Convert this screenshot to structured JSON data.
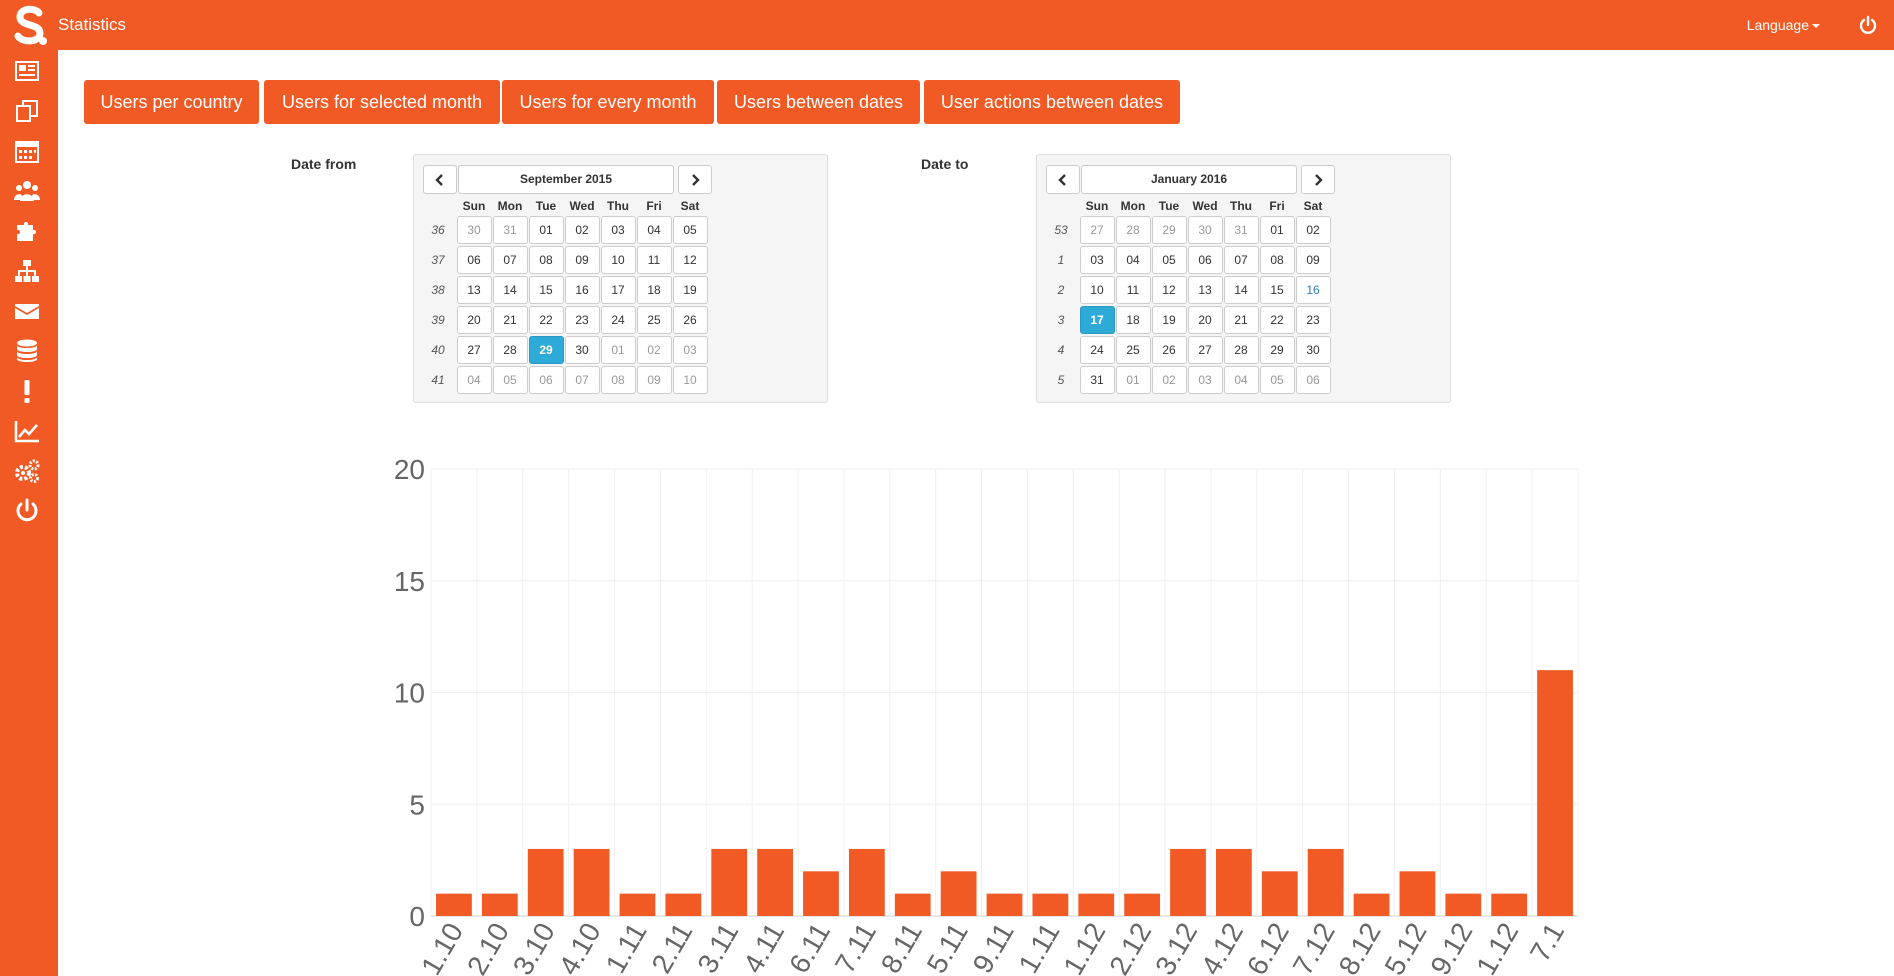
{
  "header": {
    "title": "Statistics",
    "language_label": "Language",
    "brand_color": "#f15a24"
  },
  "sidebar": {
    "icons": [
      "newspaper-icon",
      "copy-icon",
      "calendar-icon",
      "users-icon",
      "puzzle-icon",
      "sitemap-icon",
      "envelope-icon",
      "database-icon",
      "exclamation-icon",
      "line-chart-icon",
      "gears-icon",
      "power-icon"
    ]
  },
  "tabs": [
    {
      "label": "Users per country"
    },
    {
      "label": "Users for selected month"
    },
    {
      "label": "Users for every month"
    },
    {
      "label": "Users between dates"
    },
    {
      "label": "User actions between dates"
    }
  ],
  "date_from": {
    "label": "Date from",
    "month": "September 2015",
    "weekdays": [
      "Sun",
      "Mon",
      "Tue",
      "Wed",
      "Thu",
      "Fri",
      "Sat"
    ],
    "weeks": [
      {
        "num": "36",
        "days": [
          [
            "30",
            1
          ],
          [
            "31",
            1
          ],
          [
            "01",
            0
          ],
          [
            "02",
            0
          ],
          [
            "03",
            0
          ],
          [
            "04",
            0
          ],
          [
            "05",
            0
          ]
        ]
      },
      {
        "num": "37",
        "days": [
          [
            "06",
            0
          ],
          [
            "07",
            0
          ],
          [
            "08",
            0
          ],
          [
            "09",
            0
          ],
          [
            "10",
            0
          ],
          [
            "11",
            0
          ],
          [
            "12",
            0
          ]
        ]
      },
      {
        "num": "38",
        "days": [
          [
            "13",
            0
          ],
          [
            "14",
            0
          ],
          [
            "15",
            0
          ],
          [
            "16",
            0
          ],
          [
            "17",
            0
          ],
          [
            "18",
            0
          ],
          [
            "19",
            0
          ]
        ]
      },
      {
        "num": "39",
        "days": [
          [
            "20",
            0
          ],
          [
            "21",
            0
          ],
          [
            "22",
            0
          ],
          [
            "23",
            0
          ],
          [
            "24",
            0
          ],
          [
            "25",
            0
          ],
          [
            "26",
            0
          ]
        ]
      },
      {
        "num": "40",
        "days": [
          [
            "27",
            0
          ],
          [
            "28",
            0
          ],
          [
            "29",
            2
          ],
          [
            "30",
            0
          ],
          [
            "01",
            1
          ],
          [
            "02",
            1
          ],
          [
            "03",
            1
          ]
        ]
      },
      {
        "num": "41",
        "days": [
          [
            "04",
            1
          ],
          [
            "05",
            1
          ],
          [
            "06",
            1
          ],
          [
            "07",
            1
          ],
          [
            "08",
            1
          ],
          [
            "09",
            1
          ],
          [
            "10",
            1
          ]
        ]
      }
    ]
  },
  "date_to": {
    "label": "Date to",
    "month": "January 2016",
    "weekdays": [
      "Sun",
      "Mon",
      "Tue",
      "Wed",
      "Thu",
      "Fri",
      "Sat"
    ],
    "weeks": [
      {
        "num": "53",
        "days": [
          [
            "27",
            1
          ],
          [
            "28",
            1
          ],
          [
            "29",
            1
          ],
          [
            "30",
            1
          ],
          [
            "31",
            1
          ],
          [
            "01",
            0
          ],
          [
            "02",
            0
          ]
        ]
      },
      {
        "num": "1",
        "days": [
          [
            "03",
            0
          ],
          [
            "04",
            0
          ],
          [
            "05",
            0
          ],
          [
            "06",
            0
          ],
          [
            "07",
            0
          ],
          [
            "08",
            0
          ],
          [
            "09",
            0
          ]
        ]
      },
      {
        "num": "2",
        "days": [
          [
            "10",
            0
          ],
          [
            "11",
            0
          ],
          [
            "12",
            0
          ],
          [
            "13",
            0
          ],
          [
            "14",
            0
          ],
          [
            "15",
            0
          ],
          [
            "16",
            3
          ]
        ]
      },
      {
        "num": "3",
        "days": [
          [
            "17",
            2
          ],
          [
            "18",
            0
          ],
          [
            "19",
            0
          ],
          [
            "20",
            0
          ],
          [
            "21",
            0
          ],
          [
            "22",
            0
          ],
          [
            "23",
            0
          ]
        ]
      },
      {
        "num": "4",
        "days": [
          [
            "24",
            0
          ],
          [
            "25",
            0
          ],
          [
            "26",
            0
          ],
          [
            "27",
            0
          ],
          [
            "28",
            0
          ],
          [
            "29",
            0
          ],
          [
            "30",
            0
          ]
        ]
      },
      {
        "num": "5",
        "days": [
          [
            "31",
            0
          ],
          [
            "01",
            1
          ],
          [
            "02",
            1
          ],
          [
            "03",
            1
          ],
          [
            "04",
            1
          ],
          [
            "05",
            1
          ],
          [
            "06",
            1
          ]
        ]
      }
    ]
  },
  "chart_data": {
    "type": "bar",
    "color": "#f15a24",
    "categories": [
      "1.10",
      "2.10",
      "3.10",
      "4.10",
      "1.11",
      "2.11",
      "3.11",
      "4.11",
      "6.11",
      "7.11",
      "8.11",
      "5.11",
      "9.11",
      "1.11",
      "1.12",
      "2.12",
      "3.12",
      "4.12",
      "6.12",
      "7.12",
      "8.12",
      "5.12",
      "9.12",
      "1.12",
      "7.1"
    ],
    "values": [
      1,
      1,
      3,
      3,
      1,
      1,
      3,
      3,
      2,
      3,
      1,
      2,
      1,
      1,
      1,
      1,
      3,
      3,
      2,
      3,
      1,
      2,
      1,
      1,
      11
    ],
    "ylim": [
      0,
      20
    ],
    "yticks": [
      0,
      5,
      10,
      15,
      20
    ],
    "grid": true
  }
}
